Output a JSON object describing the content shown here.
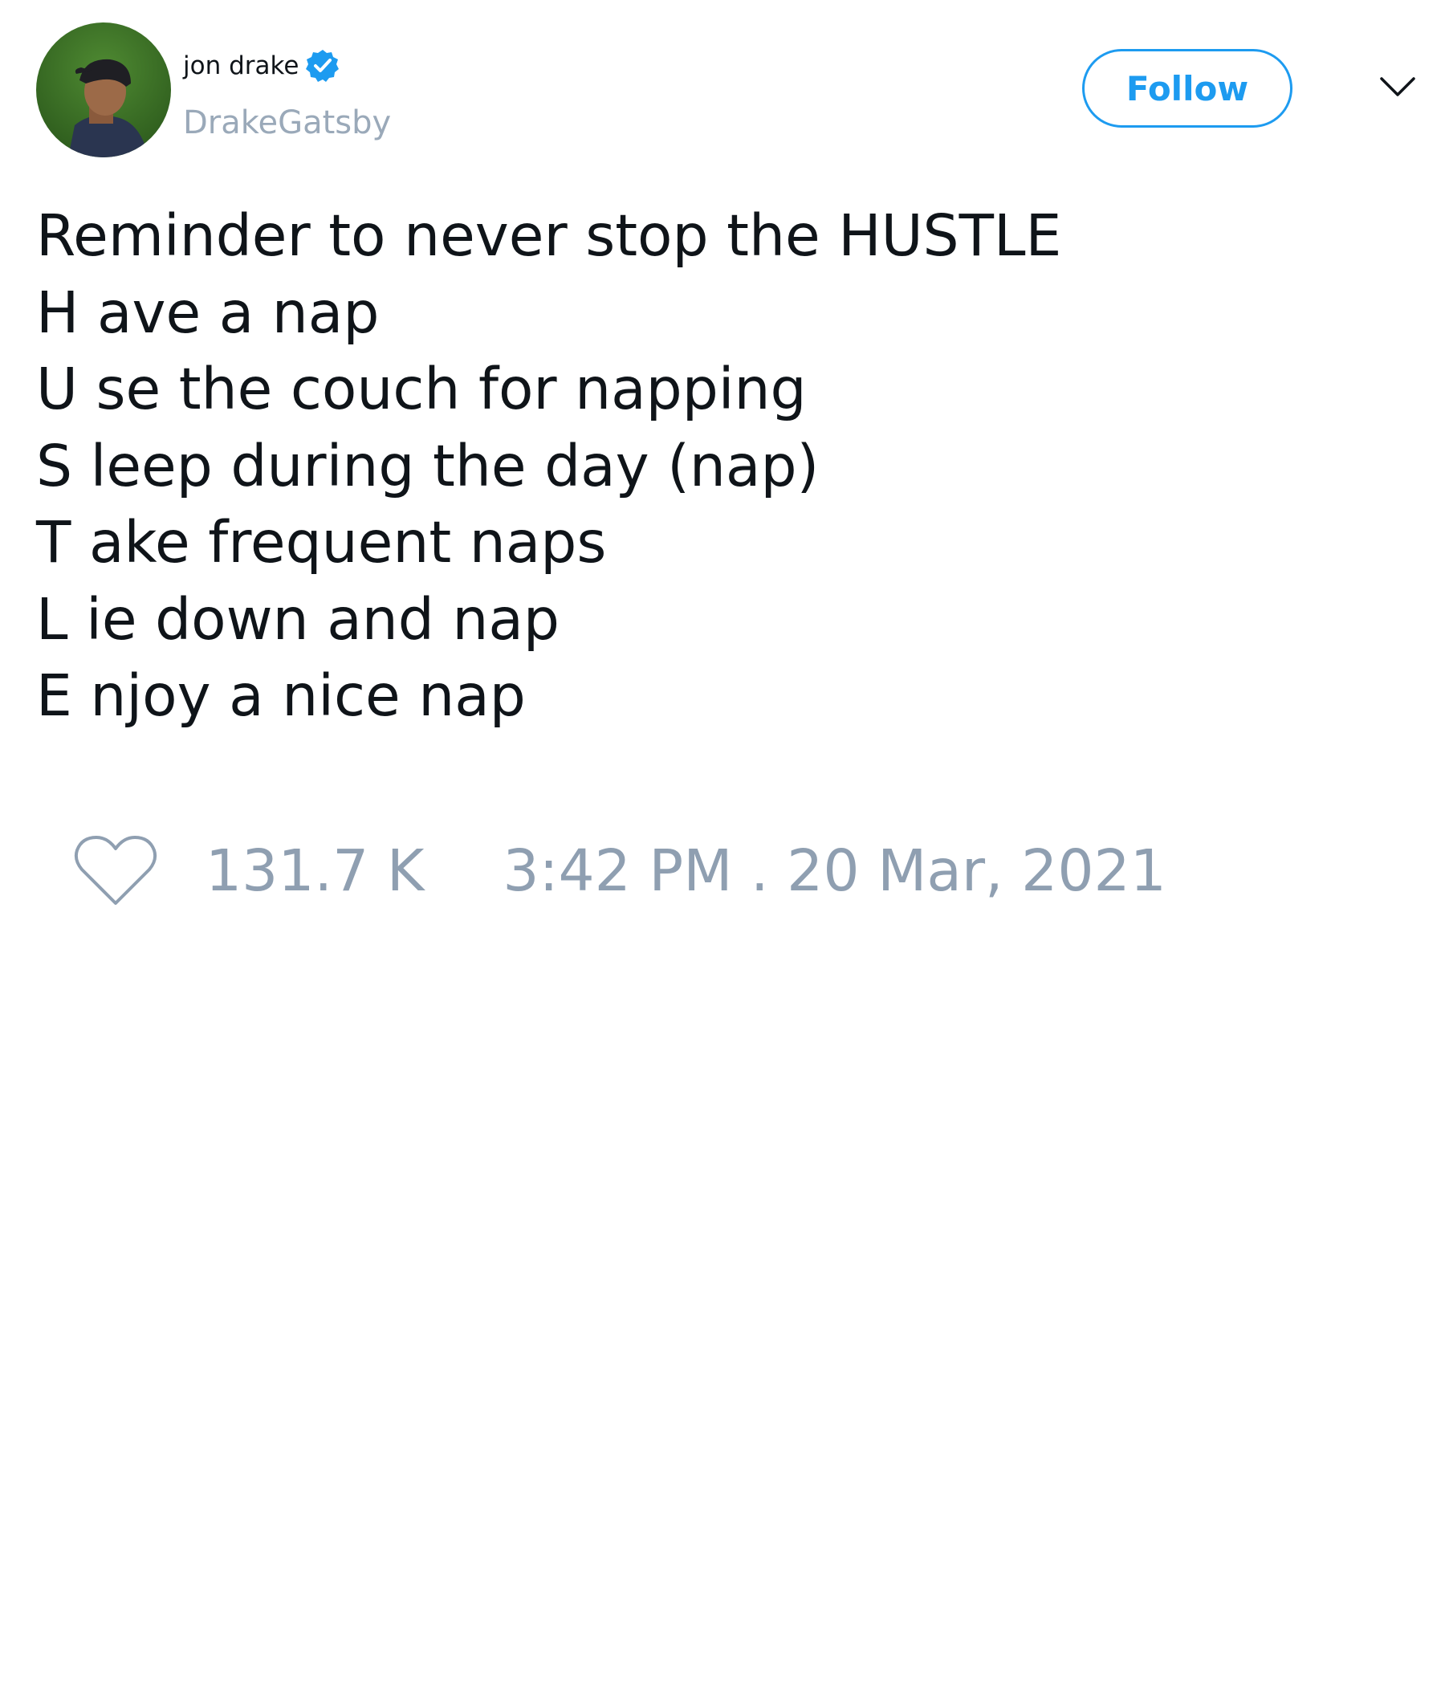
{
  "author": {
    "display_name": "jon drake",
    "handle": "DrakeGatsby",
    "verified_icon": "verified-badge-icon",
    "avatar": "profile-avatar"
  },
  "header": {
    "follow_label": "Follow",
    "more_icon": "chevron-down-icon"
  },
  "tweet": {
    "lines": [
      "Reminder to never stop the HUSTLE",
      "H ave a nap",
      "U se the couch for napping",
      "S leep during the day (nap)",
      "T ake frequent naps",
      "L ie down and nap",
      "E njoy a nice nap"
    ]
  },
  "footer": {
    "like_icon": "heart-icon",
    "like_count": "131.7 K",
    "timestamp": "3:42 PM . 20 Mar, 2021"
  },
  "colors": {
    "accent": "#1d9bf0",
    "text_primary": "#0f1419",
    "text_secondary": "#8f9fb1",
    "background": "#ffffff"
  }
}
